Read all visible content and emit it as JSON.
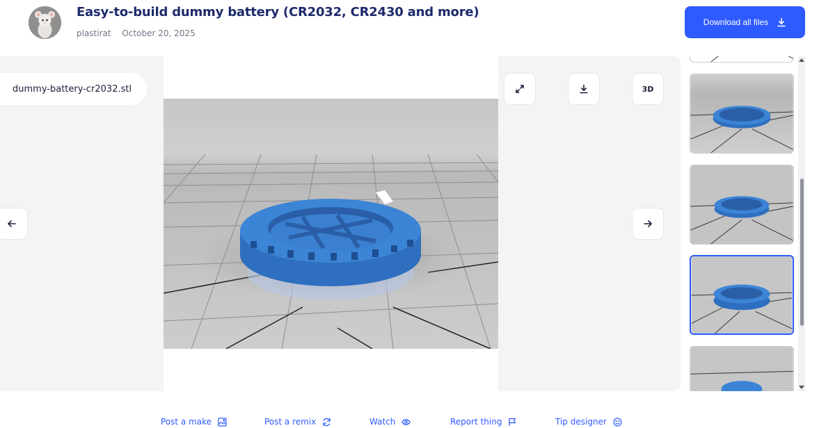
{
  "header": {
    "title": "Easy-to-build dummy battery (CR2032, CR2430 and more)",
    "author": "plastirat",
    "date": "October 20, 2025",
    "download_all_label": "Download all files"
  },
  "viewer": {
    "file_name": "dummy-battery-cr2032.stl",
    "view_3d_label": "3D"
  },
  "actions": [
    {
      "label": "Post a make",
      "icon": "image-icon"
    },
    {
      "label": "Post a remix",
      "icon": "refresh-icon"
    },
    {
      "label": "Watch",
      "icon": "eye-icon"
    },
    {
      "label": "Report thing",
      "icon": "flag-icon"
    },
    {
      "label": "Tip designer",
      "icon": "smile-icon"
    }
  ],
  "thumbnails": {
    "selected_index": 3
  },
  "colors": {
    "accent": "#2d5bff",
    "title": "#1d2a6b",
    "model": "#3c84d6",
    "panel": "#f3f4f6"
  }
}
